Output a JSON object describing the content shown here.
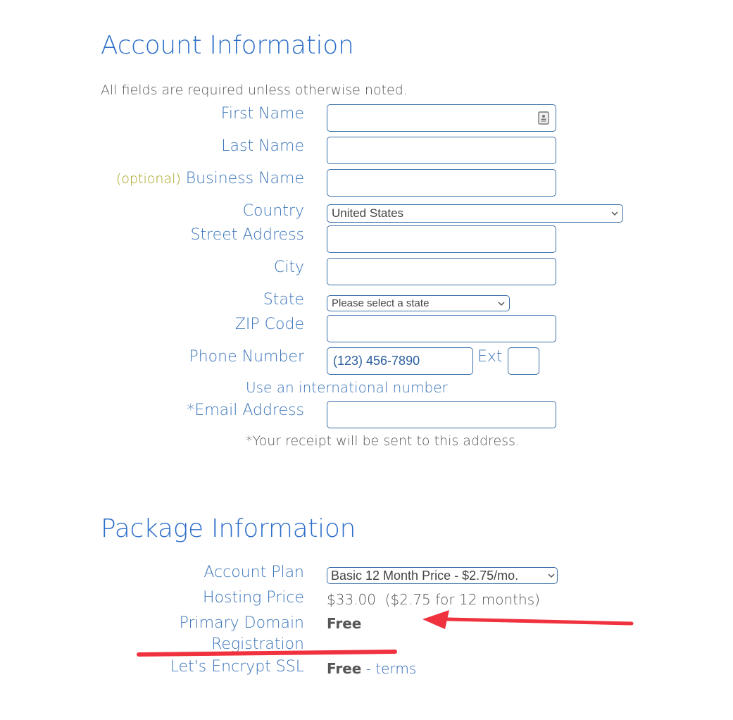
{
  "account": {
    "title": "Account Information",
    "note": "All fields are required unless otherwise noted.",
    "fields": {
      "first_name": {
        "label": "First Name",
        "value": ""
      },
      "last_name": {
        "label": "Last Name",
        "value": ""
      },
      "business_name": {
        "optional_tag": "(optional)",
        "label": "Business Name",
        "value": ""
      },
      "country": {
        "label": "Country",
        "selected": "United States"
      },
      "street_address": {
        "label": "Street Address",
        "value": ""
      },
      "city": {
        "label": "City",
        "value": ""
      },
      "state": {
        "label": "State",
        "selected": "Please select a state"
      },
      "zip": {
        "label": "ZIP Code",
        "value": ""
      },
      "phone": {
        "label": "Phone Number",
        "placeholder": "(123) 456-7890",
        "ext_label": "Ext",
        "ext_value": ""
      },
      "international_link": "Use an international number",
      "email": {
        "label": "*Email Address",
        "value": ""
      },
      "receipt_note": "*Your receipt will be sent to this address."
    }
  },
  "package": {
    "title": "Package Information",
    "account_plan": {
      "label": "Account Plan",
      "selected": "Basic 12 Month Price - $2.75/mo."
    },
    "hosting_price": {
      "label": "Hosting Price",
      "value": "$33.00",
      "detail": "($2.75 for 12 months)"
    },
    "domain": {
      "label_line1": "Primary Domain",
      "label_line2": "Registration",
      "value": "Free"
    },
    "ssl": {
      "label": "Let's Encrypt SSL",
      "value": "Free",
      "separator": " - ",
      "link": "terms"
    }
  },
  "annotations": {
    "color": "#f0323f"
  }
}
